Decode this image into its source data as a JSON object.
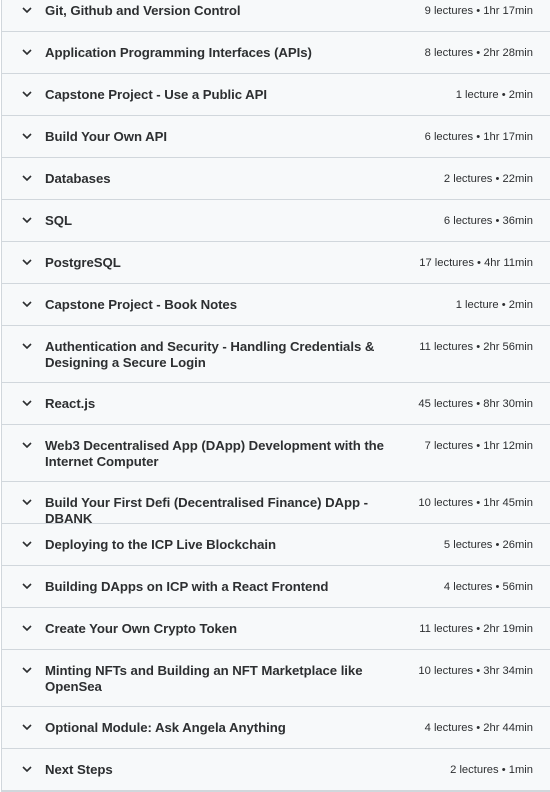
{
  "sections": [
    {
      "title": "Git, Github and Version Control",
      "meta": "9 lectures • 1hr 17min"
    },
    {
      "title": "Application Programming Interfaces (APIs)",
      "meta": "8 lectures • 2hr 28min"
    },
    {
      "title": "Capstone Project - Use a Public API",
      "meta": "1 lecture • 2min"
    },
    {
      "title": "Build Your Own API",
      "meta": "6 lectures • 1hr 17min"
    },
    {
      "title": "Databases",
      "meta": "2 lectures • 22min"
    },
    {
      "title": "SQL",
      "meta": "6 lectures • 36min"
    },
    {
      "title": "PostgreSQL",
      "meta": "17 lectures • 4hr 11min"
    },
    {
      "title": "Capstone Project - Book Notes",
      "meta": "1 lecture • 2min"
    },
    {
      "title": "Authentication and Security - Handling Credentials &\nDesigning a Secure Login",
      "meta": "11 lectures • 2hr 56min"
    },
    {
      "title": "React.js",
      "meta": "45 lectures • 8hr 30min"
    },
    {
      "title": "Web3 Decentralised App (DApp) Development with the\nInternet Computer",
      "meta": "7 lectures • 1hr 12min"
    },
    {
      "title": "Build Your First Defi (Decentralised Finance) DApp - DBANK",
      "meta": "10 lectures • 1hr 45min"
    },
    {
      "title": "Deploying to the ICP Live Blockchain",
      "meta": "5 lectures • 26min"
    },
    {
      "title": "Building DApps on ICP with a React Frontend",
      "meta": "4 lectures • 56min"
    },
    {
      "title": "Create Your Own Crypto Token",
      "meta": "11 lectures • 2hr 19min"
    },
    {
      "title": "Minting NFTs and Building an NFT Marketplace like\nOpenSea",
      "meta": "10 lectures • 3hr 34min"
    },
    {
      "title": "Optional Module: Ask Angela Anything",
      "meta": "4 lectures • 2hr 44min"
    },
    {
      "title": "Next Steps",
      "meta": "2 lectures • 1min"
    }
  ]
}
